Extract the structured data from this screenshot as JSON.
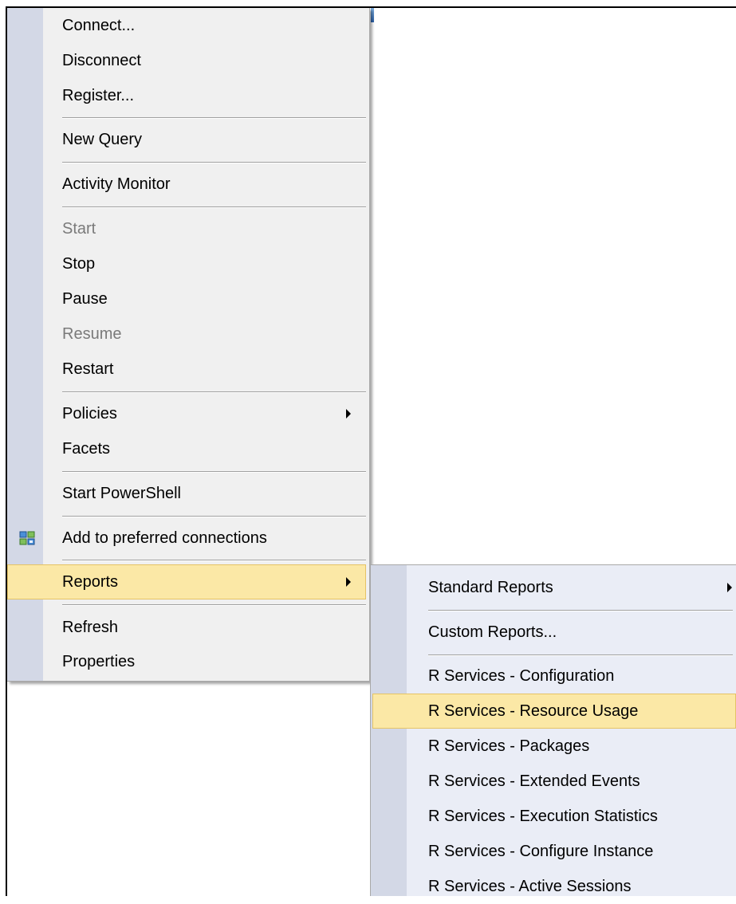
{
  "main_menu": {
    "connect": "Connect...",
    "disconnect": "Disconnect",
    "register": "Register...",
    "new_query": "New Query",
    "activity_monitor": "Activity Monitor",
    "start": "Start",
    "stop": "Stop",
    "pause": "Pause",
    "resume": "Resume",
    "restart": "Restart",
    "policies": "Policies",
    "facets": "Facets",
    "start_powershell": "Start PowerShell",
    "add_preferred": "Add to preferred connections",
    "reports": "Reports",
    "refresh": "Refresh",
    "properties": "Properties"
  },
  "reports_submenu": {
    "standard_reports": "Standard Reports",
    "custom_reports": "Custom Reports...",
    "r_configuration": "R Services - Configuration",
    "r_resource_usage": "R Services - Resource Usage",
    "r_packages": "R Services - Packages",
    "r_extended_events": "R Services - Extended Events",
    "r_execution_statistics": "R Services - Execution Statistics",
    "r_configure_instance": "R Services - Configure Instance",
    "r_active_sessions": "R Services - Active Sessions"
  },
  "icons": {
    "add_preferred_icon": "database-connection-icon",
    "submenu_arrow": "chevron-right-icon"
  },
  "colors": {
    "highlight": "#fbe8a6",
    "highlight_border": "#e5c365",
    "gutter": "#d3d8e6",
    "menu_bg": "#f0f0f0",
    "disabled_text": "#7a7a7a"
  }
}
